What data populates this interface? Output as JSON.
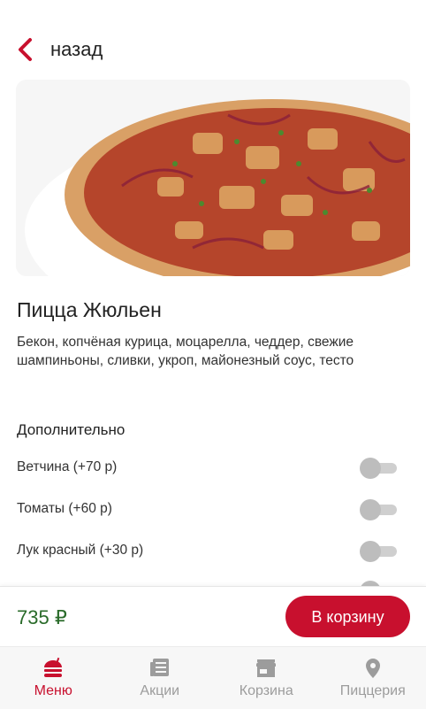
{
  "header": {
    "back_label": "назад"
  },
  "product": {
    "title": "Пицца Жюльен",
    "description": "Бекон, копчёная курица, моцарелла, чеддер, свежие шампиньоны, сливки, укроп, майонезный соус, тесто"
  },
  "extras": {
    "title": "Дополнительно",
    "items": [
      {
        "label": "Ветчина (+70 р)",
        "enabled": false
      },
      {
        "label": "Томаты (+60 р)",
        "enabled": false
      },
      {
        "label": "Лук красный (+30 р)",
        "enabled": false
      },
      {
        "label": "",
        "enabled": false
      }
    ]
  },
  "footer": {
    "price": "735 ₽",
    "cart_label": "В корзину"
  },
  "tabs": [
    {
      "label": "Меню",
      "icon": "burger-icon",
      "active": true
    },
    {
      "label": "Акции",
      "icon": "news-icon",
      "active": false
    },
    {
      "label": "Корзина",
      "icon": "store-icon",
      "active": false
    },
    {
      "label": "Пиццерия",
      "icon": "location-pin-icon",
      "active": false
    }
  ],
  "colors": {
    "accent": "#c8102e",
    "price": "#2a6b2a",
    "inactive": "#9c9c9c"
  }
}
